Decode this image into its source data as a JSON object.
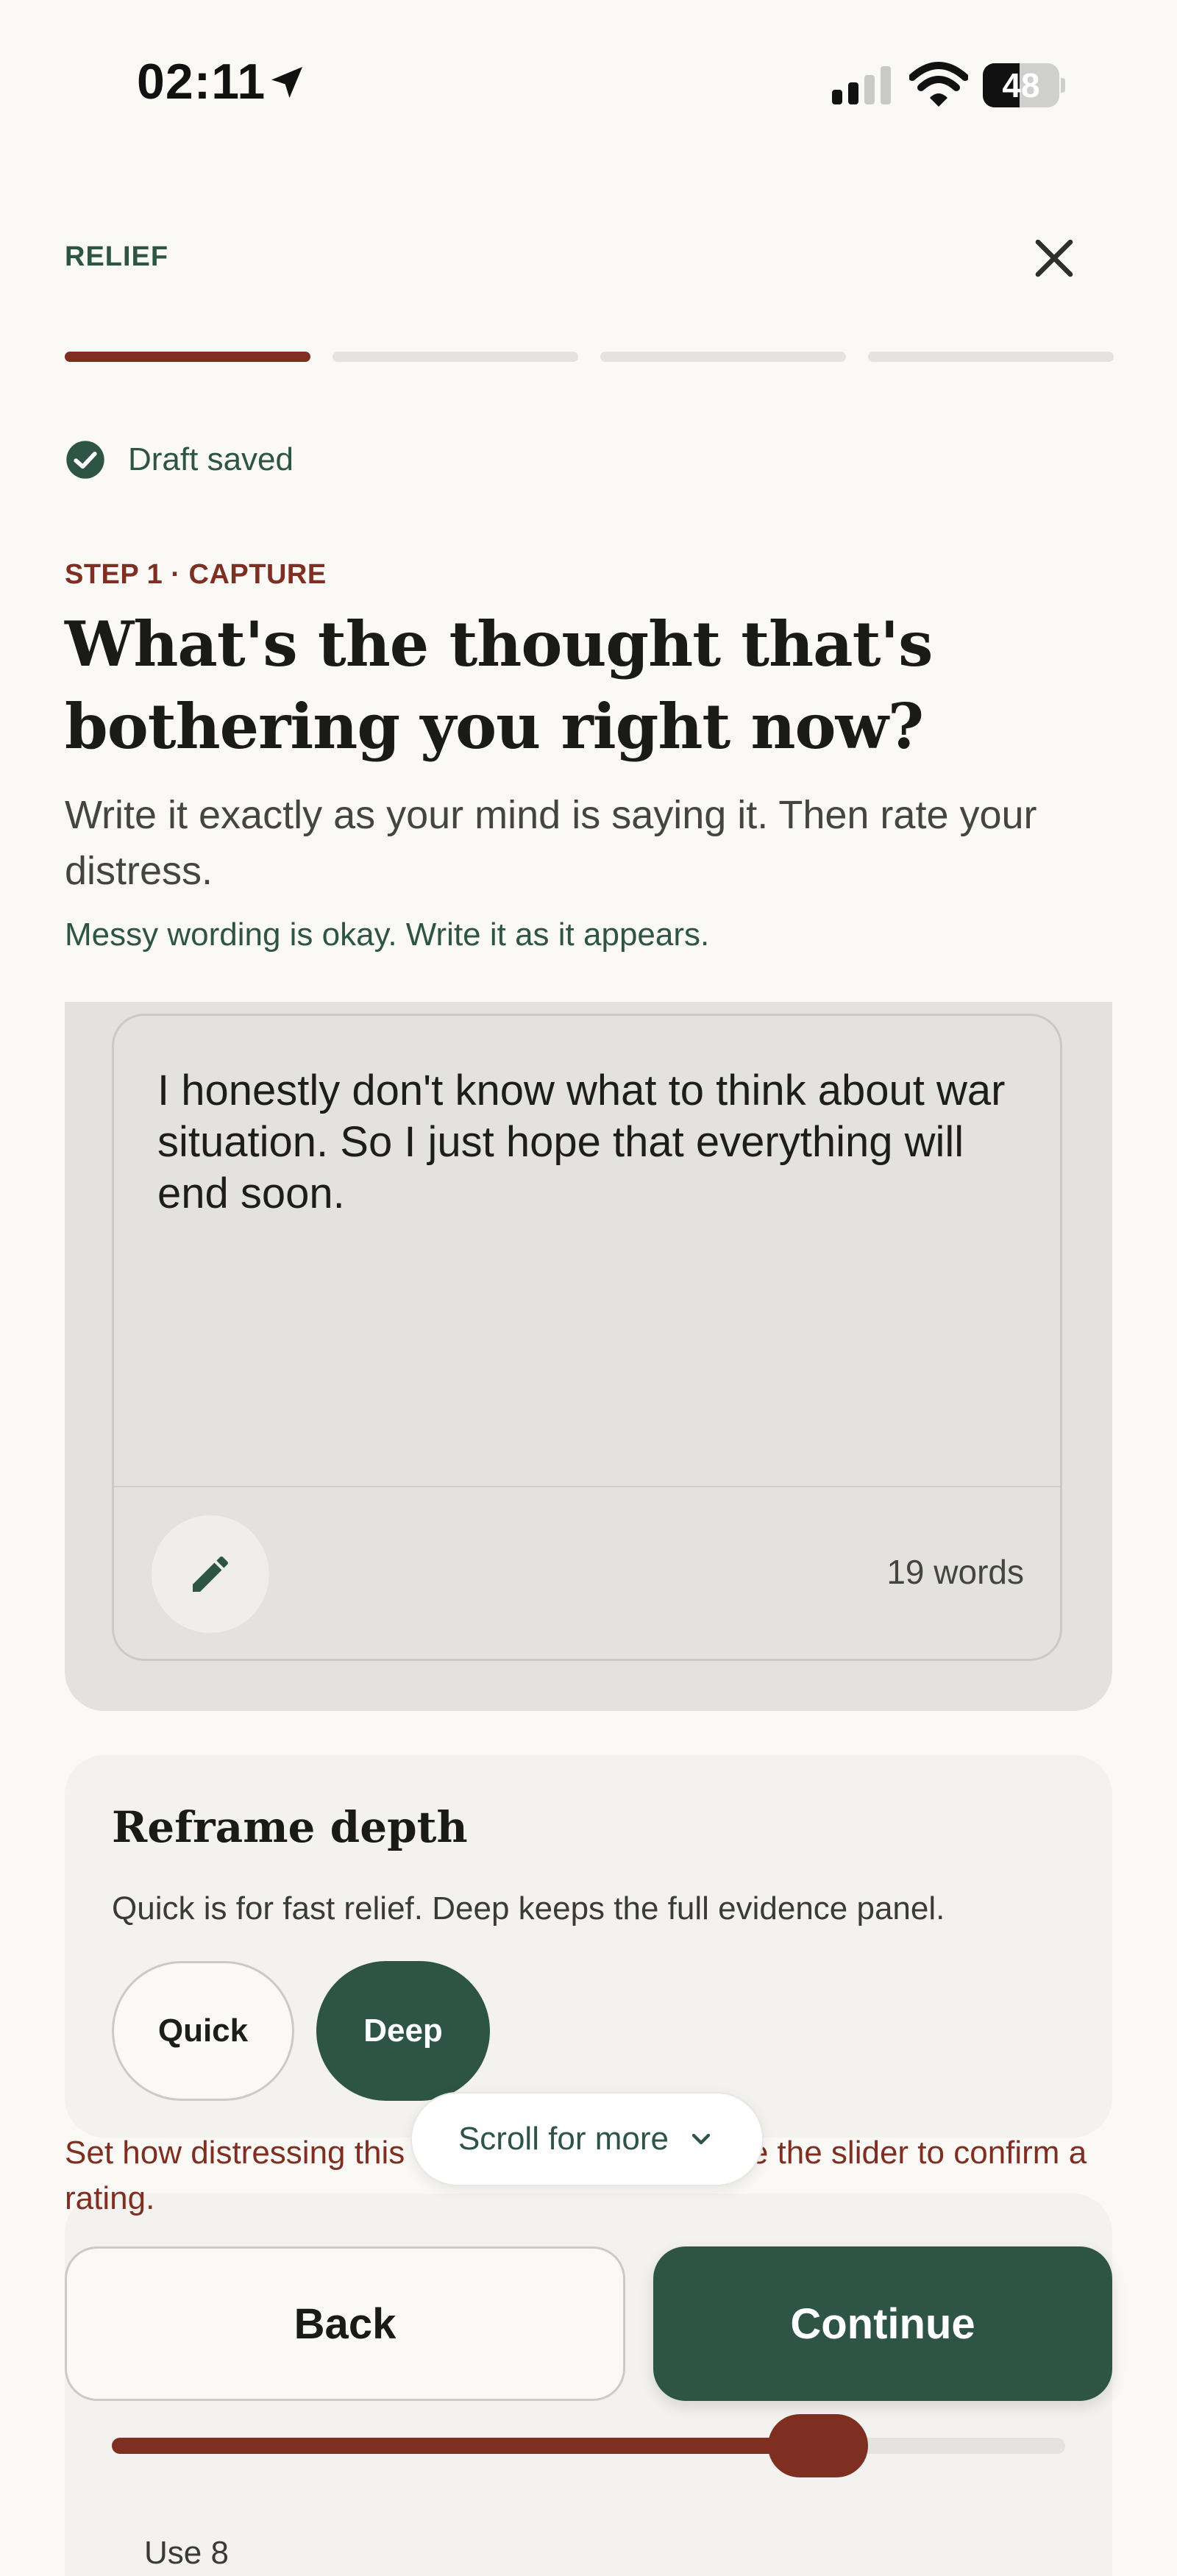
{
  "status_bar": {
    "time": "02:11",
    "battery_level": "48",
    "battery_fraction": 0.48
  },
  "header": {
    "brand": "RELIEF",
    "progress_steps": 4,
    "active_step": 1
  },
  "draft_status": "Draft saved",
  "step": {
    "label": "STEP 1 · CAPTURE",
    "title": "What's the thought that's bothering you right now?",
    "subtitle": "Write it exactly as your mind is saying it. Then rate your distress.",
    "hint": "Messy wording is okay. Write it as it appears."
  },
  "thought": {
    "text": "I honestly don't know what to think about war situation. So I just hope that everything will end soon.",
    "word_count": "19 words"
  },
  "reframe": {
    "title": "Reframe depth",
    "description": "Quick is for fast relief. Deep keeps the full evidence panel.",
    "options": [
      "Quick",
      "Deep"
    ],
    "selected": "Deep"
  },
  "warning": "Set how distressing this thought feels, then move the slider to confirm a rating.",
  "scroll_hint": "Scroll for more",
  "distress_slider": {
    "value_fraction": 0.75,
    "label_partial": "Use 8"
  },
  "actions": {
    "back": "Back",
    "continue": "Continue"
  },
  "colors": {
    "accent_red": "#7f2e22",
    "accent_green": "#2e5446",
    "background": "#faf9f6"
  },
  "icons": [
    "location-arrow-icon",
    "signal-icon",
    "wifi-icon",
    "battery-icon",
    "close-icon",
    "check-circle-icon",
    "pencil-icon",
    "chevron-down-icon"
  ]
}
